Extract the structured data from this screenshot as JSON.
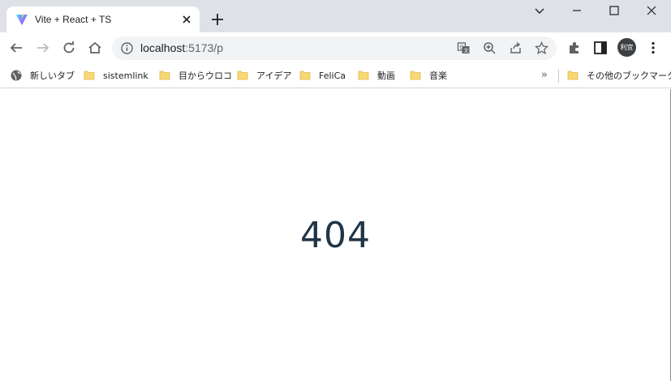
{
  "tab": {
    "title": "Vite + React + TS",
    "favicon": "vite-logo-icon"
  },
  "toolbar": {
    "url_host": "localhost",
    "url_path": ":5173/p",
    "profile_initials": "利宜"
  },
  "bookmarks": {
    "items": [
      {
        "label": "新しいタブ",
        "icon": "globe-icon"
      },
      {
        "label": "sistemlink",
        "icon": "folder-icon"
      },
      {
        "label": "目からウロコ",
        "icon": "folder-icon"
      },
      {
        "label": "アイデア",
        "icon": "folder-icon"
      },
      {
        "label": "FeliCa",
        "icon": "folder-icon"
      },
      {
        "label": "動画",
        "icon": "folder-icon"
      },
      {
        "label": "音楽",
        "icon": "folder-icon"
      }
    ],
    "more": "»",
    "other_bookmarks": "その他のブックマーク"
  },
  "page": {
    "message": "404"
  },
  "colors": {
    "tabstrip": "#dee1e6",
    "omnibox": "#f1f3f4",
    "folder": "#f8d775",
    "heading": "#213547"
  }
}
